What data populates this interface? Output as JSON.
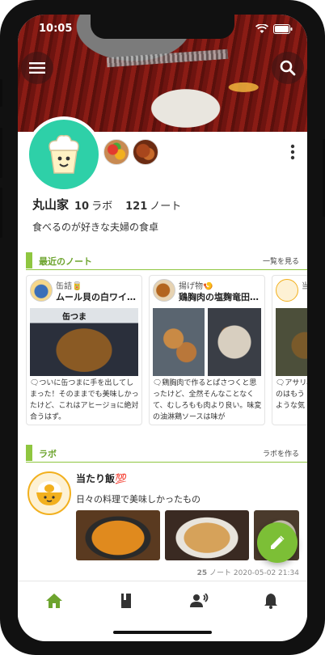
{
  "status_bar": {
    "time": "10:05"
  },
  "profile": {
    "name": "丸山家",
    "labs_count": "10",
    "labs_unit": "ラボ",
    "notes_count": "121",
    "notes_unit": "ノート",
    "bio": "食べるのが好きな夫婦の食卓"
  },
  "recent_notes": {
    "title": "最近のノート",
    "see_all": "一覧を見る",
    "cards": [
      {
        "category": "缶詰🥫",
        "title": "ムール貝の白ワイン蒸し",
        "photo_label": "缶つま",
        "excerpt": "🗨ついに缶つまに手を出してしまった！そのままでも美味しかったけど、これはアヒージョに絶対合うはず。"
      },
      {
        "category": "揚げ物🍤",
        "title": "鶏胸肉の塩麹竜田揚げ",
        "excerpt": "🗨鶏胸肉で作るとぱさつくと思ったけど、全然そんなことなくて、むしろもも肉より良い。味変の油淋鶏ソースは味が"
      },
      {
        "category": "当",
        "title": "",
        "excerpt": "🗨アサリ、め\nのはもう\nような気"
      }
    ]
  },
  "labs": {
    "title": "ラボ",
    "create": "ラボを作る",
    "item": {
      "name": "当たり飯💯",
      "description": "日々の料理で美味しかったもの",
      "notes_count": "25",
      "notes_unit": "ノート",
      "date": "2020-05-02 21:34"
    }
  },
  "icons": {
    "menu": "menu-icon",
    "search": "search-icon",
    "more": "more-vertical-icon",
    "fab": "pencil-icon",
    "tabs": [
      "home-icon",
      "book-icon",
      "people-icon",
      "bell-icon"
    ]
  },
  "colors": {
    "accent": "#8fc640",
    "accent_text": "#6da42e",
    "tab_active": "#6da42e",
    "avatar_bg": "#2ed0a8",
    "fab": "#7cbf36"
  }
}
